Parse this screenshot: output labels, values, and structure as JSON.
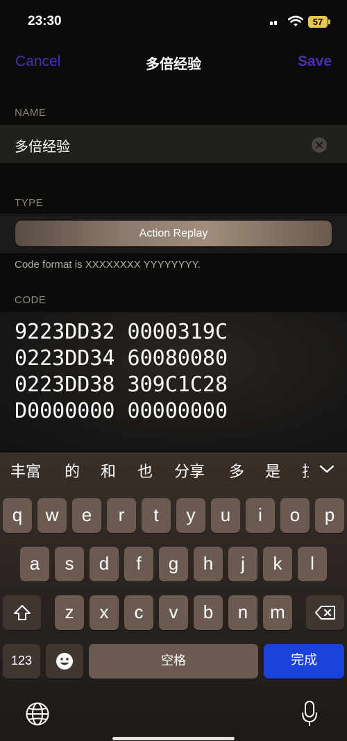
{
  "status": {
    "time": "23:30",
    "battery": "57"
  },
  "nav": {
    "cancel": "Cancel",
    "title": "多倍经验",
    "save": "Save"
  },
  "name_section": {
    "label": "NAME",
    "value": "多倍经验"
  },
  "type_section": {
    "label": "TYPE",
    "button": "Action Replay",
    "hint": "Code format is XXXXXXXX YYYYYYYY."
  },
  "code_section": {
    "label": "CODE",
    "lines": [
      "9223DD32 0000319C",
      "0223DD34 60080080",
      "0223DD38 309C1C28",
      "D0000000 00000000"
    ]
  },
  "keyboard": {
    "candidates": [
      "丰富",
      "的",
      "和",
      "也",
      "分享",
      "多",
      "是",
      "拉"
    ],
    "row1": [
      "q",
      "w",
      "e",
      "r",
      "t",
      "y",
      "u",
      "i",
      "o",
      "p"
    ],
    "row2": [
      "a",
      "s",
      "d",
      "f",
      "g",
      "h",
      "j",
      "k",
      "l"
    ],
    "row3": [
      "z",
      "x",
      "c",
      "v",
      "b",
      "n",
      "m"
    ],
    "numbers_key": "123",
    "space_key": "空格",
    "return_key": "完成"
  },
  "colors": {
    "accent": "#4a2fb3",
    "return_key": "#1a41d8",
    "battery": "#e9c54b"
  }
}
